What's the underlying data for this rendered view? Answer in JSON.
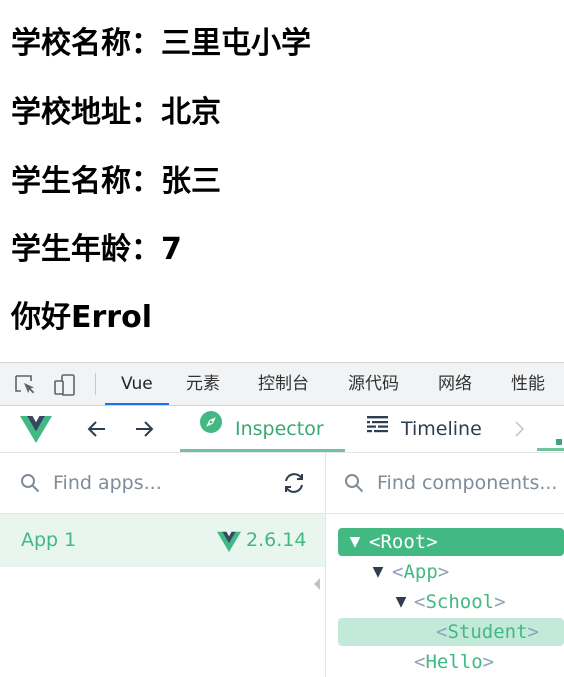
{
  "page": {
    "lines": [
      "学校名称：三里屯小学",
      "学校地址：北京",
      "学生名称：张三",
      "学生年龄：7",
      "你好Errol"
    ]
  },
  "devtools": {
    "tabs": [
      "Vue",
      "元素",
      "控制台",
      "源代码",
      "网络",
      "性能"
    ],
    "active_tab": "Vue"
  },
  "vue": {
    "tabs": [
      "Inspector",
      "Timeline"
    ],
    "active_tab": "Inspector",
    "apps_search_placeholder": "Find apps...",
    "components_search_placeholder": "Find components...",
    "app": {
      "name": "App 1",
      "version": "2.6.14"
    },
    "tree": [
      {
        "name": "Root",
        "expanded": true,
        "selected": true
      },
      {
        "name": "App",
        "expanded": true
      },
      {
        "name": "School",
        "expanded": true
      },
      {
        "name": "Student",
        "hovered": true
      },
      {
        "name": "Hello"
      }
    ]
  },
  "colors": {
    "vue_green": "#42b883",
    "vue_dark": "#35495e",
    "devtools_active": "#1a73e8"
  }
}
